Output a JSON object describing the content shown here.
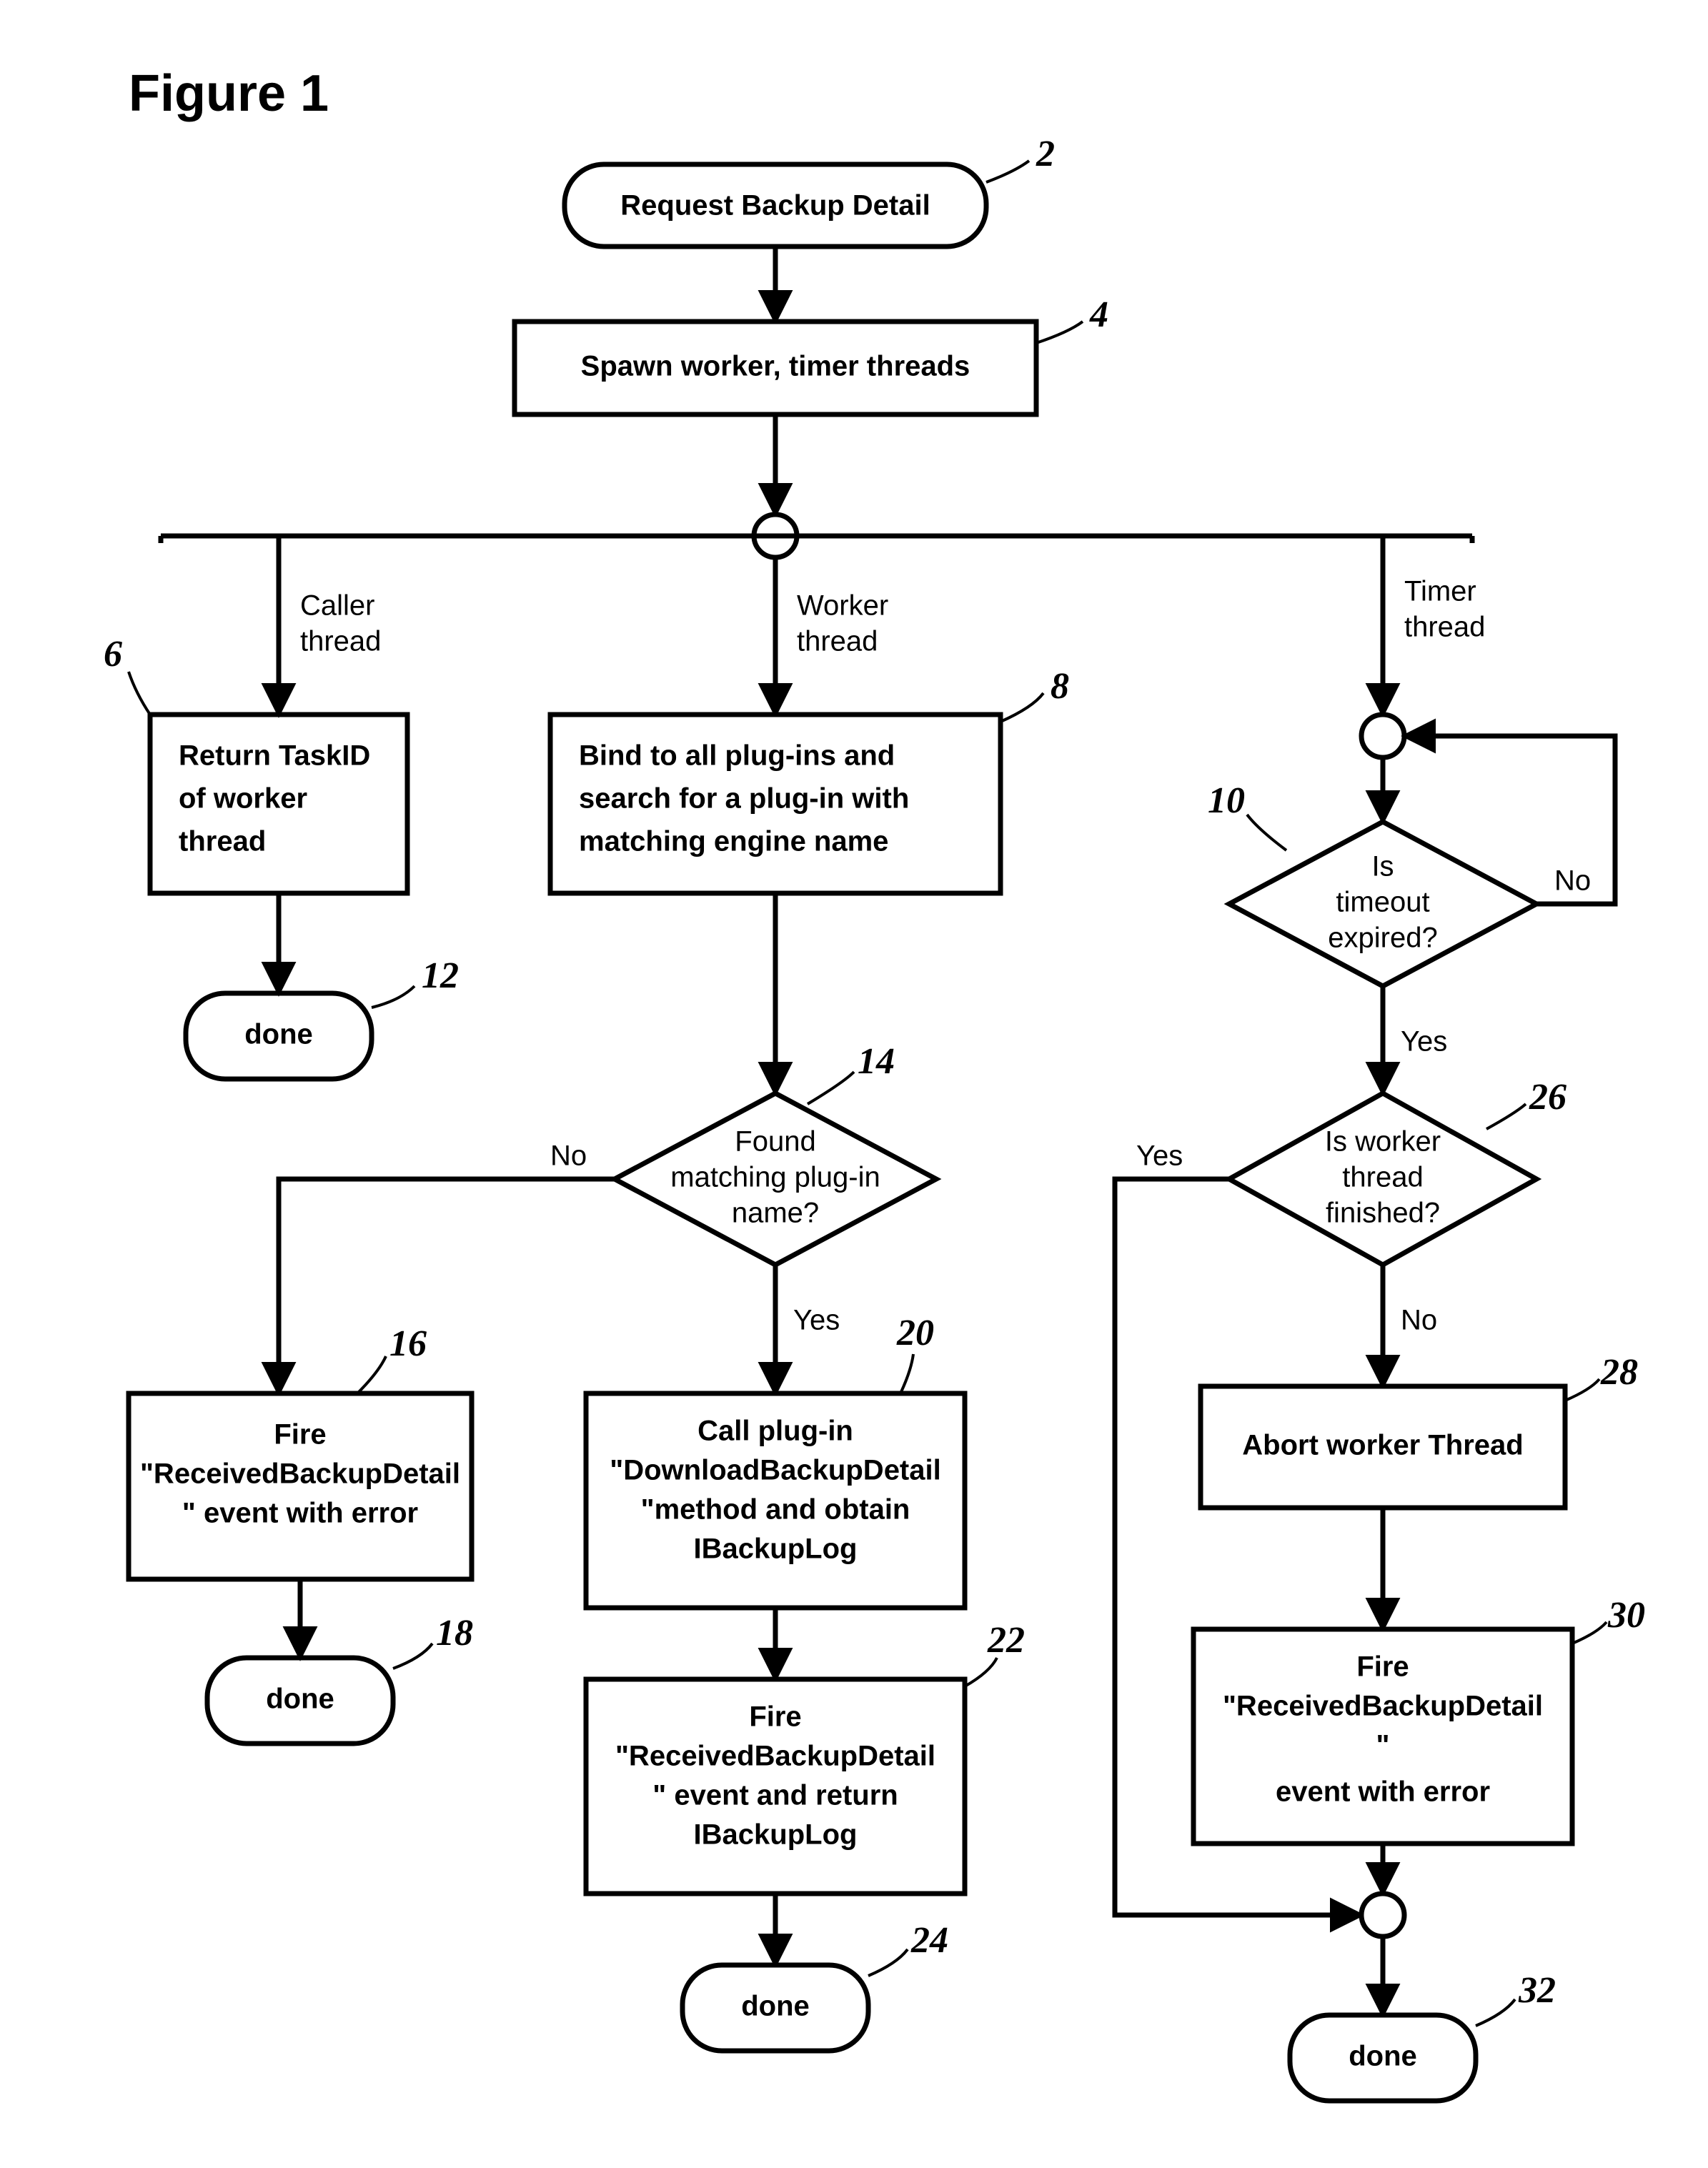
{
  "title": "Figure 1",
  "nodes": {
    "n2": "Request Backup Detail",
    "n4": "Spawn worker, timer threads",
    "n6": [
      "Return TaskID",
      "of worker",
      "thread"
    ],
    "n8": [
      "Bind to all plug-ins and",
      "search for a plug-in with",
      "matching engine name"
    ],
    "n10": [
      "Is",
      "timeout",
      "expired?"
    ],
    "n12": "done",
    "n14": [
      "Found",
      "matching plug-in",
      "name?"
    ],
    "n16": [
      "Fire",
      "\"ReceivedBackupDetail",
      "\" event with error"
    ],
    "n18": "done",
    "n20": [
      "Call plug-in",
      "\"DownloadBackupDetail",
      "\"method and obtain",
      "IBackupLog"
    ],
    "n22": [
      "Fire",
      "\"ReceivedBackupDetail",
      "\" event and return",
      "IBackupLog"
    ],
    "n24": "done",
    "n26": [
      "Is worker",
      "thread",
      "finished?"
    ],
    "n28": "Abort worker Thread",
    "n30": [
      "Fire",
      "\"ReceivedBackupDetail",
      "\"",
      "event with error"
    ],
    "n32": "done"
  },
  "labels": {
    "caller": [
      "Caller",
      "thread"
    ],
    "worker": [
      "Worker",
      "thread"
    ],
    "timer": [
      "Timer",
      "thread"
    ],
    "yes": "Yes",
    "no": "No"
  },
  "refs": {
    "r2": "2",
    "r4": "4",
    "r6": "6",
    "r8": "8",
    "r10": "10",
    "r12": "12",
    "r14": "14",
    "r16": "16",
    "r18": "18",
    "r20": "20",
    "r22": "22",
    "r24": "24",
    "r26": "26",
    "r28": "28",
    "r30": "30",
    "r32": "32"
  }
}
